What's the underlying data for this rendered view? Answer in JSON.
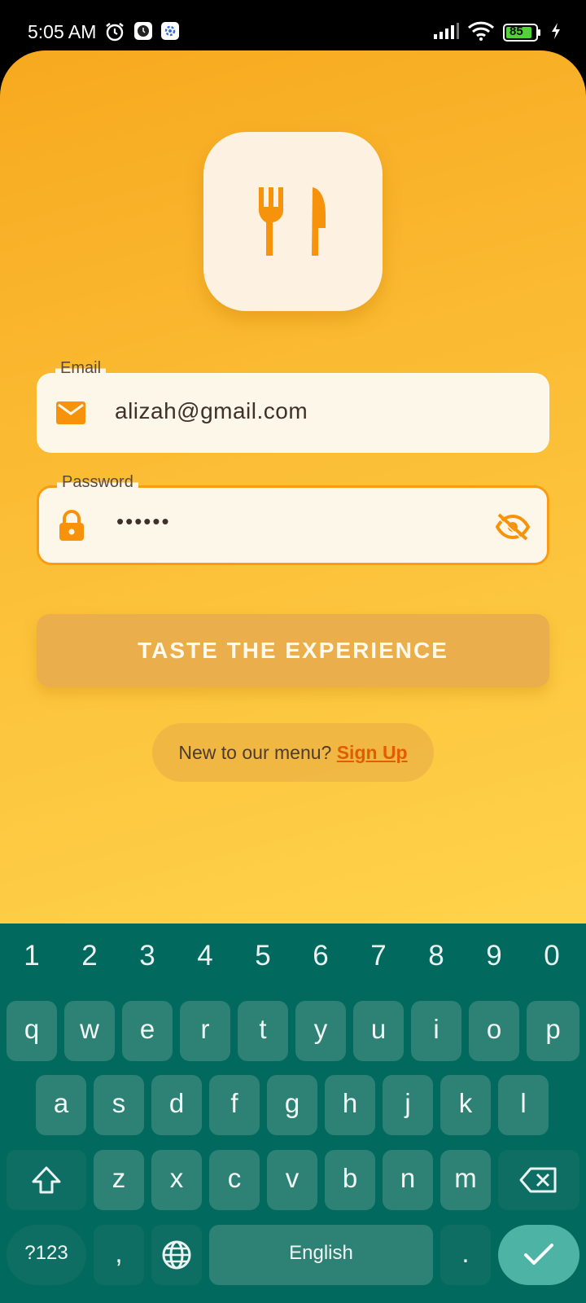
{
  "status_bar": {
    "time": "5:05 AM",
    "battery": "85",
    "icons": [
      "alarm-icon",
      "clock-app-icon",
      "settings-app-icon",
      "signal-icon",
      "wifi-icon",
      "battery-icon",
      "charging-icon"
    ]
  },
  "login": {
    "logo_icon": "restaurant-utensils-icon",
    "email": {
      "label": "Email",
      "value": "alizah@gmail.com",
      "icon": "mail-icon"
    },
    "password": {
      "label": "Password",
      "value": "••••••",
      "icon": "lock-icon",
      "toggle_icon": "eye-off-icon"
    },
    "submit_label": "TASTE THE EXPERIENCE",
    "signup_prompt": "New to our menu?",
    "signup_link": "Sign Up"
  },
  "keyboard": {
    "numbers": [
      "1",
      "2",
      "3",
      "4",
      "5",
      "6",
      "7",
      "8",
      "9",
      "0"
    ],
    "row1": [
      "q",
      "w",
      "e",
      "r",
      "t",
      "y",
      "u",
      "i",
      "o",
      "p"
    ],
    "row2": [
      "a",
      "s",
      "d",
      "f",
      "g",
      "h",
      "j",
      "k",
      "l"
    ],
    "row3": [
      "z",
      "x",
      "c",
      "v",
      "b",
      "n",
      "m"
    ],
    "symbols_key": "?123",
    "comma_key": ",",
    "space_label": "English",
    "period_key": ".",
    "icons": [
      "shift-icon",
      "backspace-icon",
      "globe-icon",
      "check-icon"
    ]
  },
  "colors": {
    "accent": "#f99c12",
    "gradient_top": "#f7a91f",
    "gradient_bottom": "#fed34b",
    "link": "#e25d00",
    "keyboard_bg": "#02695f",
    "key_bg": "#2d8275"
  }
}
